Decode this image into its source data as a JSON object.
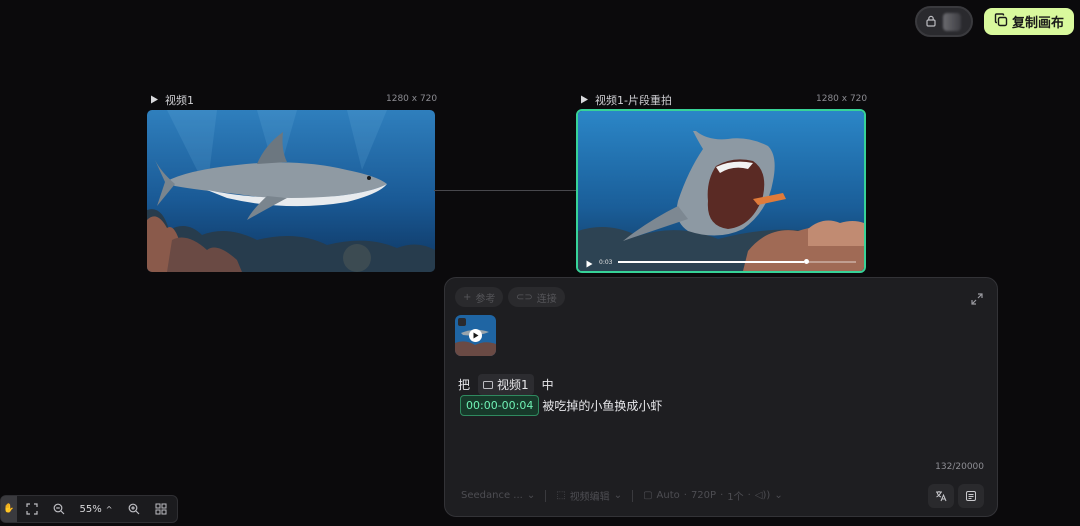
{
  "topbar": {
    "copy_canvas_label": "复制画布"
  },
  "nodes": [
    {
      "title": "视频1",
      "resolution": "1280 x 720"
    },
    {
      "title": "视频1-片段重拍",
      "resolution": "1280 x 720",
      "player_time": "0:03"
    }
  ],
  "panel": {
    "chip_reference": "参考",
    "chip_link": "连接",
    "prompt": {
      "word_ba": "把",
      "ref_name": "视频1",
      "word_zhong": "中",
      "time_range": "00:00-00:04",
      "instruction": "被吃掉的小鱼换成小虾"
    },
    "char_count": "132/20000",
    "footer": {
      "model": "Seedance ...",
      "mode": "视频编辑",
      "aspect": "Auto",
      "quality": "720P",
      "count": "1个"
    }
  },
  "zoombar": {
    "zoom_level": "55%"
  },
  "colors": {
    "accent_green": "#37d398",
    "copy_button": "#d9f99d"
  }
}
